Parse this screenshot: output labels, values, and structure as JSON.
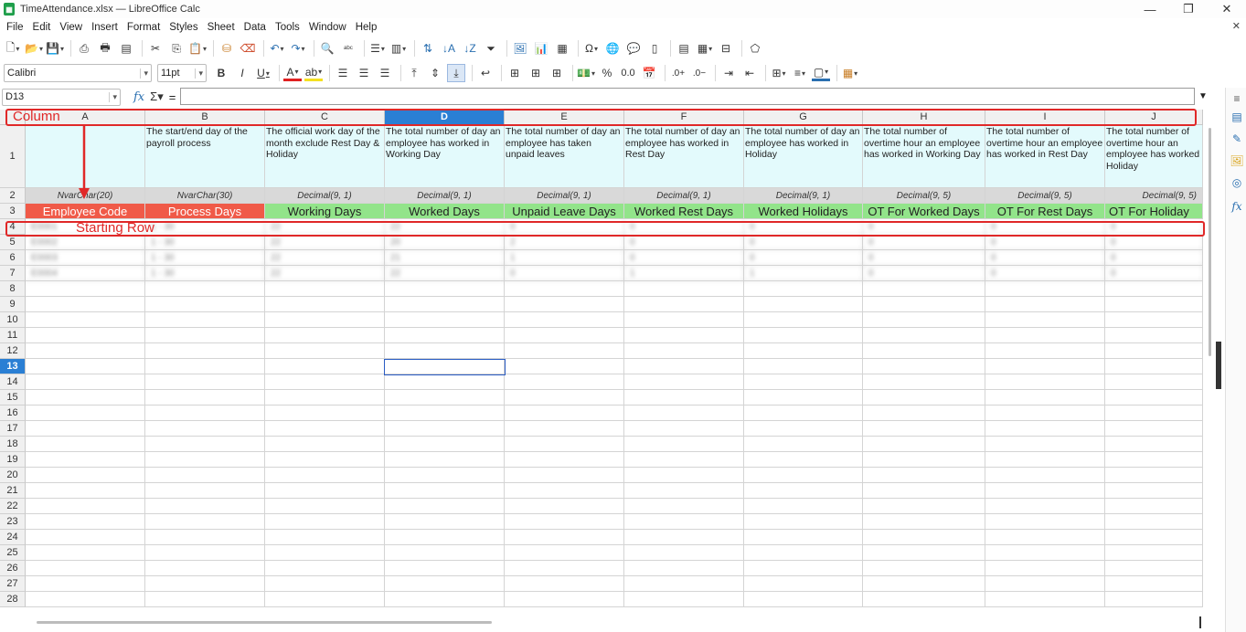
{
  "window": {
    "title": "TimeAttendance.xlsx — LibreOffice Calc",
    "app_icon": "calc-icon"
  },
  "menu": [
    "File",
    "Edit",
    "View",
    "Insert",
    "Format",
    "Styles",
    "Sheet",
    "Data",
    "Tools",
    "Window",
    "Help"
  ],
  "format_bar": {
    "font_name": "Calibri",
    "font_size": "11pt",
    "bold": "B",
    "italic": "I",
    "underline": "U"
  },
  "formula_bar": {
    "cell_ref": "D13",
    "equals": "="
  },
  "columns": [
    "A",
    "B",
    "C",
    "D",
    "E",
    "F",
    "G",
    "H",
    "I",
    "J"
  ],
  "selected_column": "D",
  "rows": [
    "1",
    "2",
    "3",
    "4",
    "5",
    "6",
    "7",
    "8",
    "9",
    "10",
    "11",
    "12",
    "13",
    "14",
    "15",
    "16",
    "17",
    "18",
    "19",
    "20",
    "21",
    "22",
    "23",
    "24",
    "25",
    "26",
    "27",
    "28"
  ],
  "selected_row": "13",
  "descriptions": [
    "",
    "The start/end day of the payroll process",
    "The official work day of the month exclude Rest Day &  Holiday",
    "The total number of day an employee has worked in Working Day",
    "The total number of day an employee has taken unpaid leaves",
    "The total number of day an employee has worked in Rest Day",
    "The total number of day an employee has worked in Holiday",
    "The total number of overtime hour an employee has worked in Working Day",
    "The total number of overtime hour an employee has worked in Rest Day",
    "The total number of overtime hour an employee has worked Holiday"
  ],
  "types": [
    "NvarChar(20)",
    "NvarChar(30)",
    "Decimal(9, 1)",
    "Decimal(9, 1)",
    "Decimal(9, 1)",
    "Decimal(9, 1)",
    "Decimal(9, 1)",
    "Decimal(9, 5)",
    "Decimal(9, 5)",
    "Decimal(9, 5)"
  ],
  "headers": [
    "Employee Code",
    "Process Days",
    "Working Days",
    "Worked Days",
    "Unpaid Leave Days",
    "Worked Rest Days",
    "Worked Holidays",
    "OT For Worked Days",
    "OT For Rest Days",
    "OT For Holiday"
  ],
  "header_colors": {
    "red": "#f05a48",
    "green": "#92e48a",
    "description_bg": "#e3fafc",
    "selection": "#2a7fd4"
  },
  "blurred_rows": [
    [
      "E0001",
      "1 - 30",
      "22",
      "22",
      "0",
      "0",
      "0",
      "0",
      "0",
      "0"
    ],
    [
      "E0002",
      "1 - 30",
      "22",
      "20",
      "2",
      "0",
      "0",
      "0",
      "0",
      "0"
    ],
    [
      "E0003",
      "1 - 30",
      "22",
      "21",
      "1",
      "0",
      "0",
      "0",
      "0",
      "0"
    ],
    [
      "E0004",
      "1 - 30",
      "22",
      "22",
      "0",
      "1",
      "1",
      "0",
      "0",
      "0"
    ]
  ],
  "annotations": {
    "column_label": "Column",
    "row_label": "Starting Row"
  }
}
